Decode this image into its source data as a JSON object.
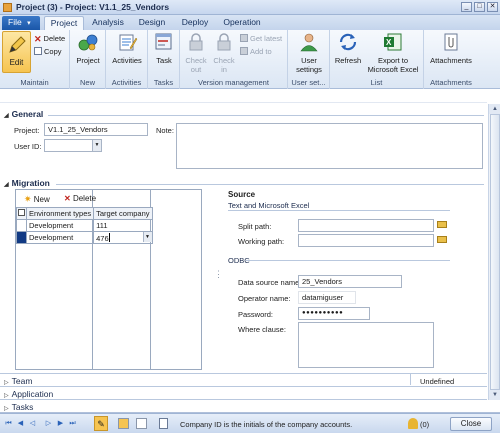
{
  "window": {
    "title": "Project (3) - Project: V1.1_25_Vendors",
    "minimize": "_",
    "maximize": "□",
    "close": "✕"
  },
  "ribbon_tabs": {
    "file": "File",
    "file_arrow": "▾",
    "tabs": [
      "Project",
      "Analysis",
      "Design",
      "Deploy",
      "Operation"
    ],
    "active": "Project"
  },
  "ribbon": {
    "maintain": {
      "label": "Maintain",
      "edit": "Edit",
      "delete": "Delete",
      "copy": "Copy"
    },
    "new": {
      "label": "New",
      "project": "Project"
    },
    "activities": {
      "label": "Activities",
      "activities": "Activities"
    },
    "tasks": {
      "label": "Tasks",
      "task": "Task"
    },
    "version": {
      "label": "Version management",
      "check_out": [
        "Check",
        "out"
      ],
      "check_in": [
        "Check",
        "in"
      ],
      "get_latest": "Get latest",
      "add_to": "Add to"
    },
    "user_settings": {
      "label": "User set...",
      "button": [
        "User",
        "settings"
      ]
    },
    "list": {
      "label": "List",
      "refresh": "Refresh",
      "export": [
        "Export to",
        "Microsoft Excel"
      ]
    },
    "attachments": {
      "label": "Attachments",
      "button": "Attachments"
    }
  },
  "general": {
    "heading": "General",
    "project_label": "Project:",
    "project_value": "V1.1_25_Vendors",
    "user_id_label": "User ID:",
    "user_id_value": "",
    "note_label": "Note:"
  },
  "migration": {
    "heading": "Migration",
    "new": "New",
    "delete": "Delete",
    "columns": [
      "Environment types",
      "Target company"
    ],
    "rows": [
      {
        "env": "Development",
        "target": "111"
      },
      {
        "env": "Development",
        "target": "476"
      }
    ],
    "source": {
      "heading": "Source",
      "excel_heading": "Text and Microsoft Excel",
      "split_path_label": "Split path:",
      "working_path_label": "Working path:",
      "odbc_heading": "ODBC",
      "dsn_label": "Data source name:",
      "dsn_value": "25_Vendors",
      "operator_label": "Operator name:",
      "operator_value": "datamiguser",
      "password_label": "Password:",
      "password_value": "●●●●●●●●●●",
      "where_label": "Where clause:"
    }
  },
  "collapsed_sections": {
    "team": "Team",
    "team_status": "Undefined",
    "application": "Application",
    "tasks": "Tasks"
  },
  "status_bar": {
    "message": "Company ID is the initials of the company accounts.",
    "close": "Close",
    "count": "(0)"
  },
  "colors": {
    "accent": "#1a56a8",
    "selected_row": "#123a84",
    "edit_highlight": "#f6c451"
  }
}
